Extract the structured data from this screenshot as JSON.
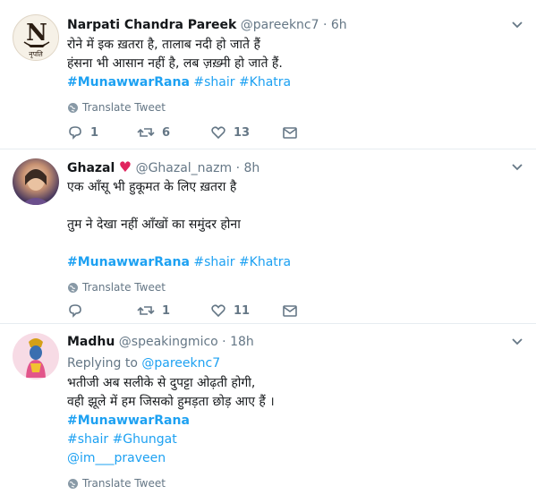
{
  "tweets": [
    {
      "name": "Narpati Chandra Pareek",
      "handle": "@pareeknc7",
      "time": "6h",
      "line1": "रोने में इक ख़तरा है, तालाब नदी हो जाते हैं",
      "line2": "हंसना भी आसान नहीं है, लब ज़ख़्मी हो जाते हैं.",
      "hashtag_main": "#MunawwarRana",
      "hashtag_2": "#shair",
      "hashtag_3": "#Khatra",
      "translate": "Translate Tweet",
      "replies": "1",
      "retweets": "6",
      "likes": "13",
      "avatar_letter": "N",
      "avatar_caption": "नृपति"
    },
    {
      "name": "Ghazal",
      "handle": "@Ghazal_nazm",
      "time": "8h",
      "line1": "एक आँसू भी हुकूमत के लिए ख़तरा है",
      "line2": "तुम ने देखा नहीं आँखों का समुंदर होना",
      "hashtag_main": "#MunawwarRana",
      "hashtag_2": "#shair",
      "hashtag_3": "#Khatra",
      "translate": "Translate Tweet",
      "replies": "",
      "retweets": "1",
      "likes": "11"
    },
    {
      "name": "Madhu",
      "handle": "@speakingmico",
      "time": "18h",
      "replying_label": "Replying to",
      "replying_handle": "@pareeknc7",
      "line1": "भतीजी अब सलीके से दुपट्टा ओढ़ती होगी,",
      "line2": "वही झूले में हम जिसको हुमड़ता छोड़ आए हैं ।",
      "hashtag_main": "#MunawwarRana",
      "hashtag_2": "#shair",
      "hashtag_3": "#Ghungat",
      "mention": "@im___praveen",
      "translate": "Translate Tweet"
    }
  ],
  "colors": {
    "link": "#1da1f2",
    "muted": "#657786",
    "heart": "#e0245e",
    "divider": "#e6ecf0"
  }
}
